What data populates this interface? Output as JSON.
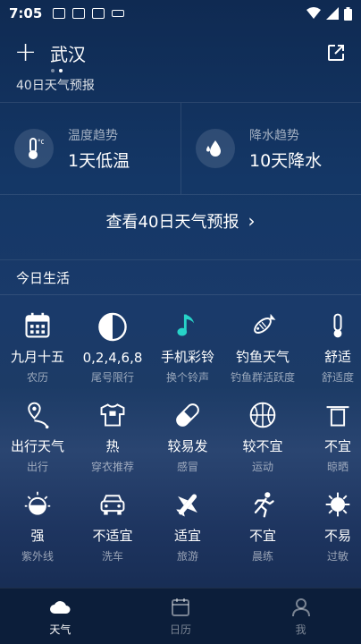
{
  "status": {
    "time": "7:05"
  },
  "header": {
    "plus": "+",
    "city": "武汉"
  },
  "forecast_title": "40日天气预报",
  "trends": [
    {
      "label": "温度趋势",
      "value": "1天低温",
      "icon": "thermometer-icon"
    },
    {
      "label": "降水趋势",
      "value": "10天降水",
      "icon": "rain-drop-icon"
    }
  ],
  "view40": {
    "label": "查看40日天气预报",
    "chevron": "›"
  },
  "section": {
    "title": "今日生活"
  },
  "life": [
    [
      {
        "main": "九月十五",
        "sub": "农历",
        "icon": "calendar-icon"
      },
      {
        "main": "0,2,4,6,8",
        "sub": "尾号限行",
        "icon": "half-circle-icon"
      },
      {
        "main": "手机彩铃",
        "sub": "换个铃声",
        "icon": "music-note-icon"
      },
      {
        "main": "钓鱼天气",
        "sub": "钓鱼群活跃度",
        "icon": "fish-icon"
      },
      {
        "main": "舒适",
        "sub": "舒适度",
        "icon": "thermometer-icon"
      }
    ],
    [
      {
        "main": "出行天气",
        "sub": "出行",
        "icon": "route-pin-icon"
      },
      {
        "main": "热",
        "sub": "穿衣推荐",
        "icon": "tshirt-icon"
      },
      {
        "main": "较易发",
        "sub": "感冒",
        "icon": "pill-icon"
      },
      {
        "main": "较不宜",
        "sub": "运动",
        "icon": "basketball-icon"
      },
      {
        "main": "不宜",
        "sub": "晾晒",
        "icon": "shirt-hanger-icon"
      }
    ],
    [
      {
        "main": "强",
        "sub": "紫外线",
        "icon": "uv-sun-icon"
      },
      {
        "main": "不适宜",
        "sub": "洗车",
        "icon": "car-icon"
      },
      {
        "main": "适宜",
        "sub": "旅游",
        "icon": "plane-icon"
      },
      {
        "main": "不宜",
        "sub": "晨练",
        "icon": "runner-icon"
      },
      {
        "main": "不易",
        "sub": "过敏",
        "icon": "allergy-icon"
      }
    ]
  ],
  "tabs": [
    {
      "label": "天气",
      "active": true,
      "icon": "cloud-tab-icon"
    },
    {
      "label": "日历",
      "active": false,
      "icon": "calendar-tab-icon"
    },
    {
      "label": "我",
      "active": false,
      "icon": "user-tab-icon"
    }
  ],
  "colors": {
    "accent_teal": "#27d3c8",
    "tab_bg": "#0c1e3a"
  }
}
